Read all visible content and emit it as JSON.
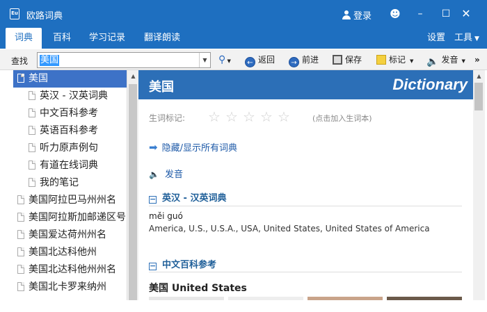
{
  "window": {
    "title": "欧路词典",
    "app_icon": "Eu",
    "login": "登录",
    "controls": [
      "smile-icon",
      "minimize-icon",
      "maximize-icon",
      "close-icon"
    ]
  },
  "menu": {
    "tabs": [
      "词典",
      "百科",
      "学习记录",
      "翻译朗读"
    ],
    "right": [
      "设置",
      "工具"
    ]
  },
  "toolbar": {
    "label": "查找",
    "search_value": "美国",
    "back": "返回",
    "forward": "前进",
    "save": "保存",
    "bookmark": "标记",
    "speak": "发音"
  },
  "tree": [
    {
      "label": "美国",
      "level": 0,
      "selected": true
    },
    {
      "label": "英汉 - 汉英词典",
      "level": 1
    },
    {
      "label": "中文百科参考",
      "level": 1
    },
    {
      "label": "英语百科参考",
      "level": 1
    },
    {
      "label": "听力原声例句",
      "level": 1
    },
    {
      "label": "有道在线词典",
      "level": 1
    },
    {
      "label": "我的笔记",
      "level": 1
    },
    {
      "label": "美国阿拉巴马州州名",
      "level": 0
    },
    {
      "label": "美国阿拉斯加邮递区号",
      "level": 0
    },
    {
      "label": "美国爱达荷州州名",
      "level": 0
    },
    {
      "label": "美国北达科他州",
      "level": 0
    },
    {
      "label": "美国北达科他州州名",
      "level": 0
    },
    {
      "label": "美国北卡罗来纳州",
      "level": 0
    }
  ],
  "entry": {
    "word": "美国",
    "brand": "Dictionary",
    "rating_label": "生词标记:",
    "rating_stars": 0,
    "rating_hint": "(点击加入生词本)",
    "toggle_all": "隐藏/显示所有词典",
    "pronounce": "发音",
    "section1_title": "英汉 - 汉英词典",
    "pinyin": "měi guó",
    "definition": "America, U.S., U.S.A., USA, United States, United States of America",
    "section2_title": "中文百科参考",
    "encyclopedia_heading": "美国 United States"
  },
  "colors": {
    "accent": "#1e6fc0",
    "header_bg": "#2c6fb7",
    "selected_bg": "#3d72c7"
  }
}
